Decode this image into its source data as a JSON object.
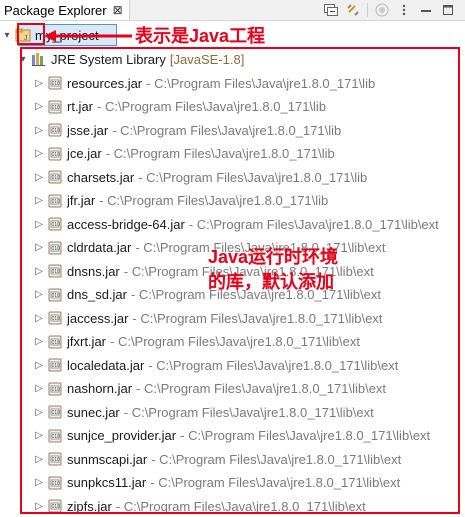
{
  "view": {
    "tab_label": "Package Explorer",
    "close_glyph": "⊠"
  },
  "tree": {
    "project": "my_project",
    "library": {
      "name": "JRE System Library",
      "decoration": "[JavaSE-1.8]"
    },
    "jars": [
      {
        "name": "resources.jar",
        "path": "- C:\\Program Files\\Java\\jre1.8.0_171\\lib"
      },
      {
        "name": "rt.jar",
        "path": "- C:\\Program Files\\Java\\jre1.8.0_171\\lib"
      },
      {
        "name": "jsse.jar",
        "path": "- C:\\Program Files\\Java\\jre1.8.0_171\\lib"
      },
      {
        "name": "jce.jar",
        "path": "- C:\\Program Files\\Java\\jre1.8.0_171\\lib"
      },
      {
        "name": "charsets.jar",
        "path": "- C:\\Program Files\\Java\\jre1.8.0_171\\lib"
      },
      {
        "name": "jfr.jar",
        "path": "- C:\\Program Files\\Java\\jre1.8.0_171\\lib"
      },
      {
        "name": "access-bridge-64.jar",
        "path": "- C:\\Program Files\\Java\\jre1.8.0_171\\lib\\ext"
      },
      {
        "name": "cldrdata.jar",
        "path": "- C:\\Program Files\\Java\\jre1.8.0_171\\lib\\ext"
      },
      {
        "name": "dnsns.jar",
        "path": "- C:\\Program Files\\Java\\jre1.8.0_171\\lib\\ext"
      },
      {
        "name": "dns_sd.jar",
        "path": "- C:\\Program Files\\Java\\jre1.8.0_171\\lib\\ext"
      },
      {
        "name": "jaccess.jar",
        "path": "- C:\\Program Files\\Java\\jre1.8.0_171\\lib\\ext"
      },
      {
        "name": "jfxrt.jar",
        "path": "- C:\\Program Files\\Java\\jre1.8.0_171\\lib\\ext"
      },
      {
        "name": "localedata.jar",
        "path": "- C:\\Program Files\\Java\\jre1.8.0_171\\lib\\ext"
      },
      {
        "name": "nashorn.jar",
        "path": "- C:\\Program Files\\Java\\jre1.8.0_171\\lib\\ext"
      },
      {
        "name": "sunec.jar",
        "path": "- C:\\Program Files\\Java\\jre1.8.0_171\\lib\\ext"
      },
      {
        "name": "sunjce_provider.jar",
        "path": "- C:\\Program Files\\Java\\jre1.8.0_171\\lib\\ext"
      },
      {
        "name": "sunmscapi.jar",
        "path": "- C:\\Program Files\\Java\\jre1.8.0_171\\lib\\ext"
      },
      {
        "name": "sunpkcs11.jar",
        "path": "- C:\\Program Files\\Java\\jre1.8.0_171\\lib\\ext"
      },
      {
        "name": "zipfs.jar",
        "path": "- C:\\Program Files\\Java\\jre1.8.0_171\\lib\\ext"
      }
    ]
  },
  "annotations": {
    "java_project_note": "表示是Java工程",
    "runtime_line1": "Java运行时环境",
    "runtime_line2": "的库，默认添加"
  },
  "colors": {
    "annotation_red": "#e4001a",
    "selection_blue": "#d9e8fb"
  }
}
